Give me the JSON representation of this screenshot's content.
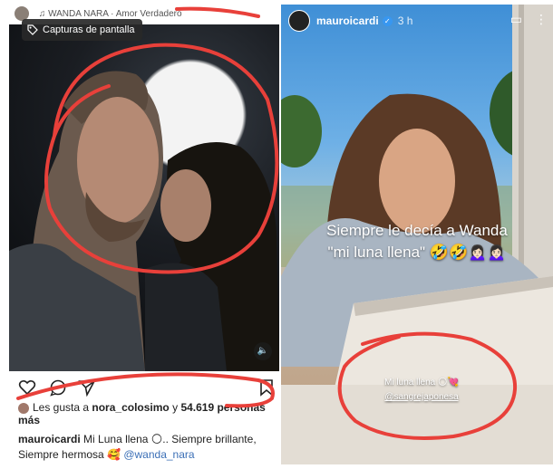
{
  "post": {
    "username": "WANDA NARA",
    "song": "Amor Verdadero",
    "screenshot_chip": "Capturas de pantalla",
    "likes_prefix": "Les gusta a",
    "likes_user": "nora_colosimo",
    "likes_middle": "y",
    "likes_count": "54.619 personas",
    "likes_suffix": "más",
    "caption_user": "mauroicardi",
    "caption_text": "Mi Luna llena 🌕.. Siempre brillante,",
    "caption_text2": "Siempre hermosa 🥰",
    "caption_mention": "@wanda_nara"
  },
  "story": {
    "username": "mauroicardi",
    "time": "3 h",
    "text_line1": "Siempre le decía a Wanda",
    "text_line2": "\"mi luna llena\" 🤣🤣🙍🏻‍♀️🙍🏻‍♀️",
    "sticker_text": "Mi luna llena 🌕💘",
    "sticker_handle": "@sangrejaponesa"
  },
  "colors": {
    "annotation_red": "#e8403a",
    "verified_blue": "#3897f0",
    "mention_blue": "#3b6fb6"
  }
}
